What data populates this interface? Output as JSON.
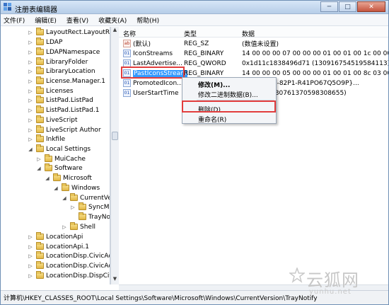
{
  "window": {
    "title": "注册表编辑器",
    "controls": [
      "─",
      "□",
      "✕"
    ]
  },
  "menubar": [
    "文件(F)",
    "编辑(E)",
    "查看(V)",
    "收藏夹(A)",
    "帮助(H)"
  ],
  "tree": {
    "items": [
      {
        "label": "LayoutRect.LayoutRect.",
        "expander": "▷"
      },
      {
        "label": "LDAP",
        "expander": "▷"
      },
      {
        "label": "LDAPNamespace",
        "expander": "▷"
      },
      {
        "label": "LibraryFolder",
        "expander": "▷"
      },
      {
        "label": "LibraryLocation",
        "expander": "▷"
      },
      {
        "label": "License.Manager.1",
        "expander": "▷"
      },
      {
        "label": "Licenses",
        "expander": "▷"
      },
      {
        "label": "ListPad.ListPad",
        "expander": "▷"
      },
      {
        "label": "ListPad.ListPad.1",
        "expander": "▷"
      },
      {
        "label": "LiveScript",
        "expander": "▷"
      },
      {
        "label": "LiveScript Author",
        "expander": "▷"
      },
      {
        "label": "lnkfile",
        "expander": "▷"
      },
      {
        "label": "Local Settings",
        "expander": "◢"
      },
      {
        "label": "MuiCache",
        "expander": "▷"
      },
      {
        "label": "Software",
        "expander": "◢"
      },
      {
        "label": "Microsoft",
        "expander": "◢"
      },
      {
        "label": "Windows",
        "expander": "◢"
      },
      {
        "label": "CurrentVe",
        "expander": "◢"
      },
      {
        "label": "SyncM",
        "expander": "▷"
      },
      {
        "label": "TrayNo",
        "expander": ""
      },
      {
        "label": "Shell",
        "expander": "▷"
      },
      {
        "label": "LocationApi",
        "expander": "▷"
      },
      {
        "label": "LocationApi.1",
        "expander": "▷"
      },
      {
        "label": "LocationDisp.CivicAddr",
        "expander": "▷"
      },
      {
        "label": "LocationDisp.CivicAddr",
        "expander": "▷"
      },
      {
        "label": "LocationDisp.DispCivic",
        "expander": "▷"
      }
    ]
  },
  "list": {
    "columns": [
      "名称",
      "类型",
      "数据"
    ],
    "rows": [
      {
        "icon": "ab",
        "icon_kind": "sz",
        "name": "(默认)",
        "type": "REG_SZ",
        "data": "(数值未设置)"
      },
      {
        "icon": "01",
        "icon_kind": "bin",
        "name": "IconStreams",
        "type": "REG_BINARY",
        "data": "14 00 00 00 07 00 00 00 01 00 01 00 1c 00 00..."
      },
      {
        "icon": "01",
        "icon_kind": "bin",
        "name": "LastAdvertise...",
        "type": "REG_QWORD",
        "data": "0x1d11c1838496d71 (130916754519584113)"
      },
      {
        "icon": "01",
        "icon_kind": "bin",
        "name": "PastIconsStream",
        "type": "REG_BINARY",
        "data": "14 00 00 00 05 00 00 00 01 00 01 00 8c 03 00..."
      },
      {
        "icon": "01",
        "icon_kind": "bin",
        "name": "PromotedIcon...",
        "type": "",
        "data": "23R3-4229-82P1-R41PO67Q5O9P}..."
      },
      {
        "icon": "01",
        "icon_kind": "bin",
        "name": "UserStartTime",
        "type": "",
        "data": "4dafb2f (130761370598308655)"
      }
    ]
  },
  "context_menu": {
    "items": [
      "修改(M)...",
      "修改二进制数据(B)...",
      "删除(D)",
      "重命名(R)"
    ]
  },
  "statusbar": {
    "path": "计算机\\HKEY_CLASSES_ROOT\\Local Settings\\Software\\Microsoft\\Windows\\CurrentVersion\\TrayNotify"
  },
  "watermark": {
    "title": "云狐网",
    "url": "yunhu.net"
  },
  "colors": {
    "selection": "#3399ff",
    "highlight": "#e23d3d"
  }
}
